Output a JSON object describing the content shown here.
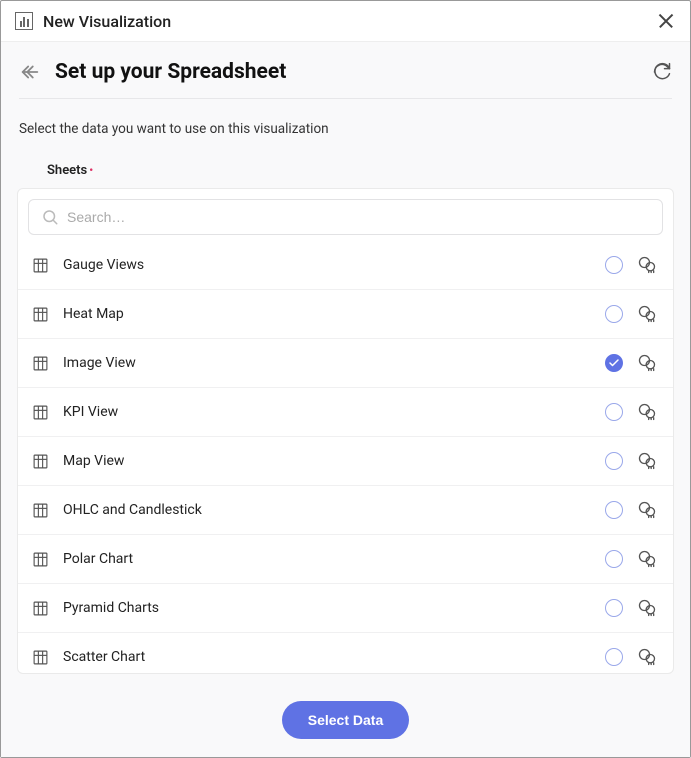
{
  "titlebar": {
    "title": "New Visualization"
  },
  "header": {
    "title": "Set up your Spreadsheet"
  },
  "subtext": "Select the data you want to use on this visualization",
  "sheets_label": "Sheets",
  "search": {
    "placeholder": "Search…"
  },
  "sheets": [
    {
      "label": "Gauge Views",
      "selected": false
    },
    {
      "label": "Heat Map",
      "selected": false
    },
    {
      "label": "Image View",
      "selected": true
    },
    {
      "label": "KPI View",
      "selected": false
    },
    {
      "label": "Map View",
      "selected": false
    },
    {
      "label": "OHLC and Candlestick",
      "selected": false
    },
    {
      "label": "Polar Chart",
      "selected": false
    },
    {
      "label": "Pyramid Charts",
      "selected": false
    },
    {
      "label": "Scatter Chart",
      "selected": false
    }
  ],
  "footer": {
    "primary_label": "Select Data"
  }
}
